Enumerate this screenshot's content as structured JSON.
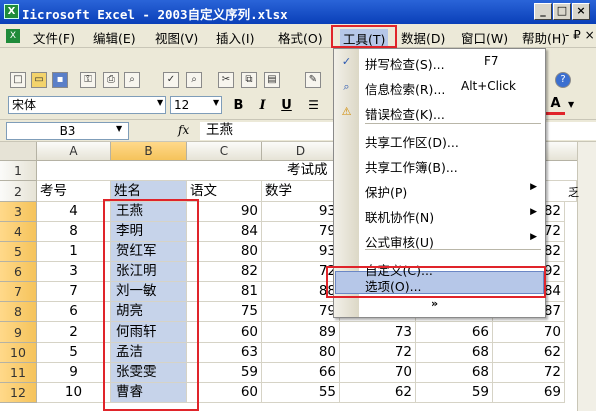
{
  "window": {
    "app_icon": "excel-icon",
    "title": "Microsoft Excel - 2003自定义序列.xlsx",
    "title_visible": "Iicrosoft Excel - 2003自定义序列.xlsx",
    "buttons": [
      "_",
      "□",
      "×"
    ]
  },
  "menubar": {
    "items": [
      "文件(F)",
      "编辑(E)",
      "视图(V)",
      "插入(I)",
      "格式(O)",
      "工具(T)",
      "数据(D)",
      "窗口(W)",
      "帮助(H)"
    ],
    "active": "工具(T)",
    "accent": "#e0242a"
  },
  "toolbar": {
    "font_name": "宋体",
    "font_size": "12",
    "bold": "B",
    "italic": "I",
    "underline": "U",
    "font_color_label": "A"
  },
  "formula_bar": {
    "name_box": "B3",
    "fx": "fx",
    "value": "王燕"
  },
  "sheet": {
    "col_headers": [
      "A",
      "B",
      "C",
      "D"
    ],
    "row_headers": [
      "1",
      "2",
      "3",
      "4",
      "5",
      "6",
      "7",
      "8",
      "9",
      "10",
      "11",
      "12"
    ],
    "title_fragment": "考试成",
    "headers": [
      "考号",
      "姓名",
      "语文",
      "数学"
    ],
    "rows": [
      {
        "id": "4",
        "name": "王燕",
        "chinese": "90",
        "math": "93",
        "e": "",
        "f": "82"
      },
      {
        "id": "8",
        "name": "李明",
        "chinese": "84",
        "math": "79",
        "e": "",
        "f": "72"
      },
      {
        "id": "1",
        "name": "贺红军",
        "chinese": "80",
        "math": "93",
        "e": "",
        "f": "82"
      },
      {
        "id": "3",
        "name": "张江明",
        "chinese": "82",
        "math": "72",
        "e": "",
        "f": "92"
      },
      {
        "id": "7",
        "name": "刘一敏",
        "chinese": "81",
        "math": "88",
        "e": "",
        "f": "84"
      },
      {
        "id": "6",
        "name": "胡亮",
        "chinese": "75",
        "math": "79",
        "e": "",
        "f": "87"
      },
      {
        "id": "2",
        "name": "何雨轩",
        "chinese": "60",
        "math": "89",
        "e": "73",
        "e2": "66",
        "f": "70"
      },
      {
        "id": "5",
        "name": "孟洁",
        "chinese": "63",
        "math": "80",
        "e": "72",
        "e2": "68",
        "f": "62"
      },
      {
        "id": "9",
        "name": "张雯雯",
        "chinese": "59",
        "math": "66",
        "e": "70",
        "e2": "68",
        "f": "72"
      },
      {
        "id": "10",
        "name": "曹睿",
        "chinese": "60",
        "math": "55",
        "e": "62",
        "e2": "59",
        "f": "69"
      }
    ],
    "selection_color": "#c6d3ea"
  },
  "tools_menu": {
    "items": [
      {
        "label": "拼写检查(S)...",
        "shortcut": "F7",
        "icon": "spellcheck-icon"
      },
      {
        "label": "信息检索(R)...",
        "shortcut": "Alt+Click",
        "icon": "research-icon"
      },
      {
        "label": "错误检查(K)...",
        "shortcut": "",
        "icon": "error-check-icon"
      },
      {
        "label": "共享工作区(D)...",
        "shortcut": ""
      },
      {
        "label": "共享工作簿(B)...",
        "shortcut": ""
      },
      {
        "label": "保护(P)",
        "shortcut": "",
        "submenu": true
      },
      {
        "label": "联机协作(N)",
        "shortcut": "",
        "submenu": true
      },
      {
        "label": "公式审核(U)",
        "shortcut": "",
        "submenu": true
      },
      {
        "label": "自定义(C)...",
        "shortcut": ""
      },
      {
        "label": "选项(O)...",
        "shortcut": "",
        "highlighted": true
      }
    ],
    "expand_icon": "double-chevron-down-icon"
  }
}
